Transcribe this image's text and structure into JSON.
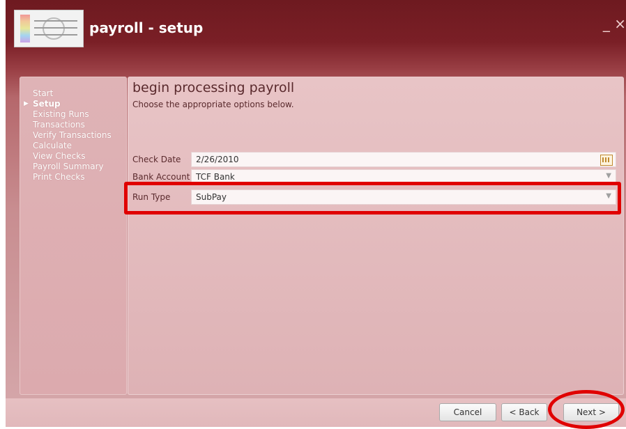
{
  "window": {
    "title": "payroll - setup",
    "controls": "_ ×"
  },
  "sidebar": {
    "items": [
      {
        "label": "Start",
        "active": false
      },
      {
        "label": "Setup",
        "active": true
      },
      {
        "label": "Existing Runs",
        "active": false
      },
      {
        "label": "Transactions",
        "active": false
      },
      {
        "label": "Verify Transactions",
        "active": false
      },
      {
        "label": "Calculate",
        "active": false
      },
      {
        "label": "View Checks",
        "active": false
      },
      {
        "label": "Payroll Summary",
        "active": false
      },
      {
        "label": "Print Checks",
        "active": false
      }
    ]
  },
  "main": {
    "title": "begin processing payroll",
    "subtitle": "Choose the appropriate options below.",
    "fields": {
      "check_date": {
        "label": "Check Date",
        "value": "2/26/2010",
        "icon": "calendar-icon"
      },
      "bank_account": {
        "label": "Bank Account",
        "value": "TCF Bank",
        "icon": "chevron-down-icon"
      },
      "run_type": {
        "label": "Run Type",
        "value": "SubPay",
        "icon": "chevron-down-icon"
      }
    }
  },
  "footer": {
    "cancel_label": "Cancel",
    "back_label": "< Back",
    "next_label": "Next >"
  },
  "colors": {
    "title_bar": "#6e1a20",
    "highlight": "#e00000"
  }
}
